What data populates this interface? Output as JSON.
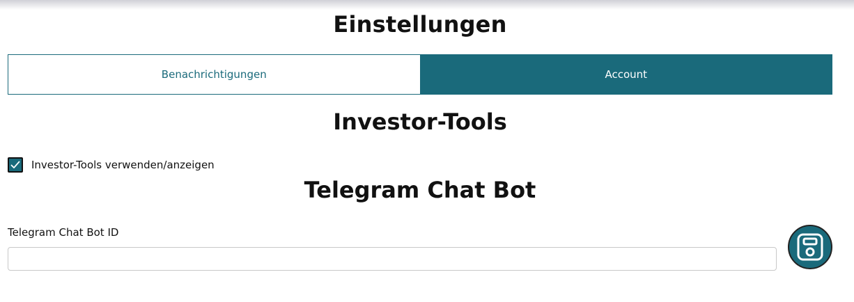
{
  "page": {
    "title": "Einstellungen"
  },
  "tabs": [
    {
      "label": "Benachrichtigungen",
      "active": false
    },
    {
      "label": "Account",
      "active": true
    }
  ],
  "investor_tools": {
    "heading": "Investor-Tools",
    "checkbox_label": "Investor-Tools verwenden/anzeigen",
    "checked": true
  },
  "telegram": {
    "heading": "Telegram Chat Bot",
    "field_label": "Telegram Chat Bot ID",
    "field_value": "",
    "field_placeholder": "",
    "save_icon": "floppy-disk-icon"
  },
  "colors": {
    "accent": "#1a6a7b",
    "text": "#111111",
    "background": "#ffffff"
  }
}
